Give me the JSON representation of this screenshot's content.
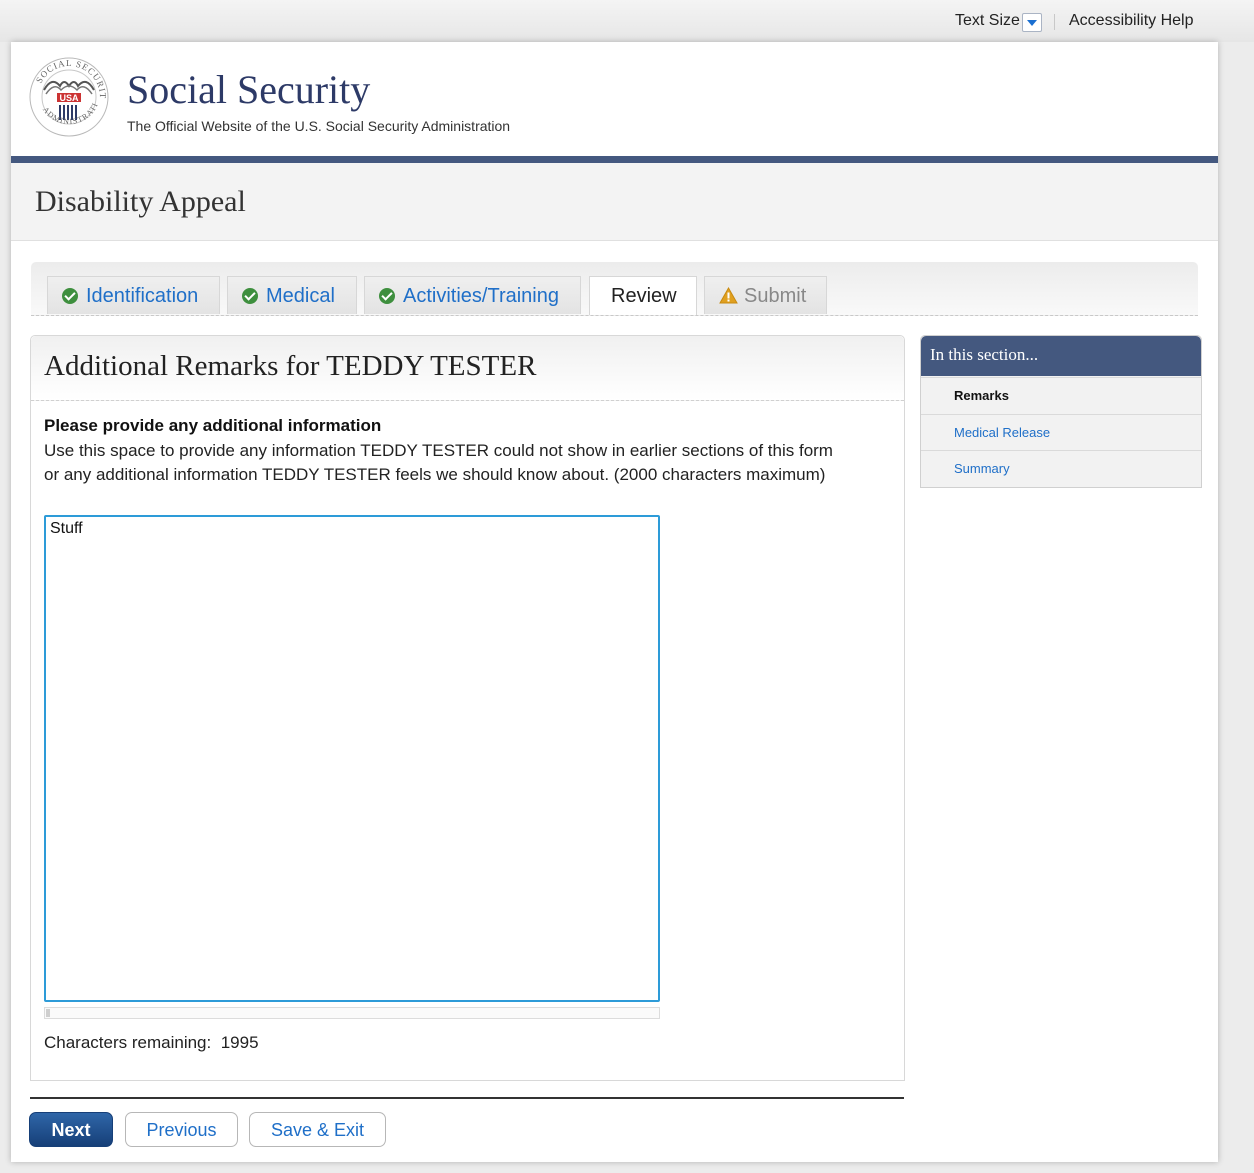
{
  "utility": {
    "text_size_label": "Text Size",
    "accessibility_help": "Accessibility Help"
  },
  "header": {
    "site_title": "Social Security",
    "site_subtitle": "The Official Website of the U.S. Social Security Administration",
    "brand_color": "#44587f"
  },
  "page": {
    "title": "Disability Appeal"
  },
  "tabs": [
    {
      "label": "Identification",
      "status": "complete",
      "icon": "check-circle-icon"
    },
    {
      "label": "Medical",
      "status": "complete",
      "icon": "check-circle-icon"
    },
    {
      "label": "Activities/Training",
      "status": "complete",
      "icon": "check-circle-icon"
    },
    {
      "label": "Review",
      "status": "active"
    },
    {
      "label": "Submit",
      "status": "disabled",
      "icon": "warning-icon"
    }
  ],
  "form": {
    "heading": "Additional Remarks for TEDDY TESTER",
    "question_label": "Please provide any additional information",
    "question_help": "Use this space to provide any information TEDDY TESTER could not show in earlier sections of this form or any additional information TEDDY TESTER feels we should know about. (2000 characters maximum)",
    "remarks_value": "Stuff",
    "chars_remaining_label": "Characters remaining:",
    "chars_remaining_value": "1995"
  },
  "buttons": {
    "next": "Next",
    "previous": "Previous",
    "save_exit": "Save & Exit"
  },
  "sidenav": {
    "title": "In this section...",
    "items": [
      {
        "label": "Remarks",
        "current": true
      },
      {
        "label": "Medical Release",
        "current": false
      },
      {
        "label": "Summary",
        "current": false
      }
    ]
  },
  "colors": {
    "link": "#1f6fc8",
    "focus_border": "#2d9bd8",
    "check_green": "#3e8f3e",
    "warning_orange": "#e0a020",
    "primary_button": "#1f4f8f"
  }
}
